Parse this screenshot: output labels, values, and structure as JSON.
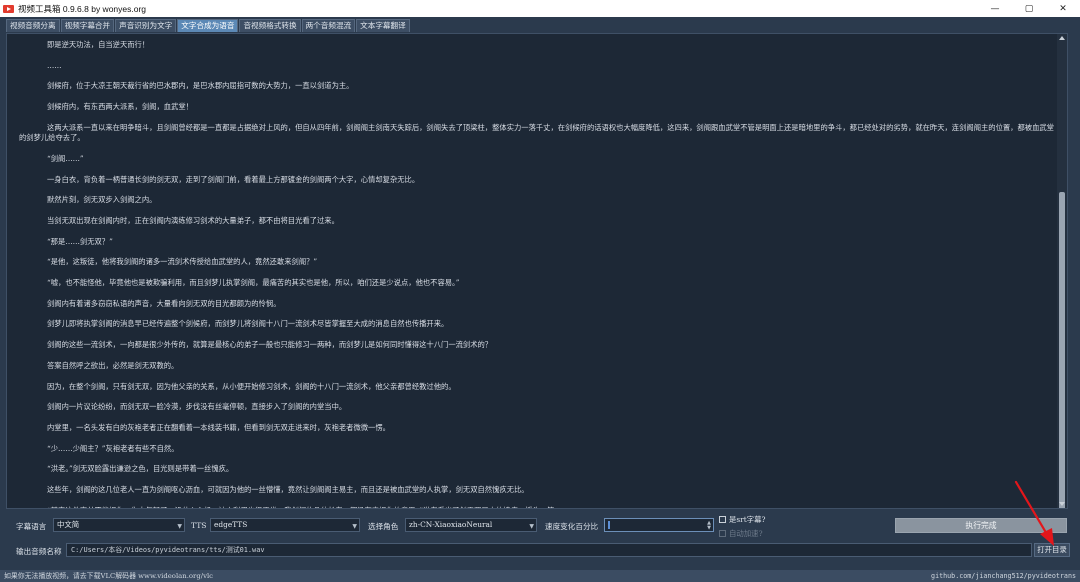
{
  "window": {
    "title": "视频工具箱 0.9.6.8 by wonyes.org",
    "controls": [
      "—",
      "▢",
      "✕"
    ]
  },
  "tabs": [
    {
      "label": "视频音频分离",
      "active": false
    },
    {
      "label": "视频字幕合并",
      "active": false
    },
    {
      "label": "声音识别为文字",
      "active": false
    },
    {
      "label": "文字合成为语音",
      "active": true
    },
    {
      "label": "音视频格式转换",
      "active": false
    },
    {
      "label": "两个音频混流",
      "active": false
    },
    {
      "label": "文本字幕翻译",
      "active": false
    }
  ],
  "text_content": [
    {
      "text": "即是逆天功法，自当逆天而行！",
      "wrap": false
    },
    {
      "text": "……",
      "wrap": false
    },
    {
      "text": "剑候府，位于大凉王朝天裁行省的巴水郡内，是巴水郡内屈指可数的大势力，一直以剑道为主。",
      "wrap": false
    },
    {
      "text": "剑候府内，有东西两大派系，剑阁，血武堂！",
      "wrap": false
    },
    {
      "text": "这两大派系一直以来在明争暗斗，且剑阁曾经都是一直都是占据绝对上风的，但自从四年前，剑阁阁主剑南天失踪后，剑阁失去了顶梁柱，整体实力一落千丈，在剑候府的话语权也大幅度降低，这四来，剑阁跟血武堂不管是明面上还是暗地里的争斗，都已经处对的劣势，就在昨天，连剑阁阁主的位置，都被血武堂的剑梦儿给夺去了。",
      "wrap": true
    },
    {
      "text": "“剑阁……”",
      "wrap": false
    },
    {
      "text": "一身白衣，背负着一柄普通长剑的剑无双，走到了剑阁门前，看着最上方那镀金的剑阁两个大字，心情却复杂无比。",
      "wrap": false
    },
    {
      "text": "默然片刻，剑无双步入剑阁之内。",
      "wrap": false
    },
    {
      "text": "当剑无双出现在剑阁内时，正在剑阁内演练修习剑术的大量弟子，都不由将目光看了过来。",
      "wrap": false
    },
    {
      "text": "“那是……剑无双？”",
      "wrap": false
    },
    {
      "text": "“是他，这叛徒，他将我剑阁的诸多一流剑术传授给血武堂的人，竟然还敢来剑阁？”",
      "wrap": false
    },
    {
      "text": "“嘘，也不能怪他，毕竟他也是被欺骗利用，而且剑梦儿执掌剑阁，最痛苦的其实也是他，所以，咱们还是少说点，他也不容易。”",
      "wrap": false
    },
    {
      "text": "剑阁内有着诸多窃窃私语的声音，大量看向剑无双的目光都颇为的怜悯。",
      "wrap": false
    },
    {
      "text": "剑梦儿即将执掌剑阁的消息早已经传遍整个剑候府，而剑梦儿将剑阁十八门一流剑术尽皆掌握至大成的消息自然也传播开来。",
      "wrap": false
    },
    {
      "text": "剑阁的这些一流剑术，一向都是很少外传的，就算是最核心的弟子一般也只能修习一两种，而剑梦儿是如何同时懂得这十八门一流剑术的？",
      "wrap": false
    },
    {
      "text": "答案自然呼之欲出，必然是剑无双教的。",
      "wrap": false
    },
    {
      "text": "因为，在整个剑阁，只有剑无双，因为他父亲的关系，从小便开始修习剑术，剑阁的十八门一流剑术，他父亲都曾经教过他的。",
      "wrap": false
    },
    {
      "text": "剑阁内一片议论纷纷，而剑无双一脸冷漠，步伐没有丝毫停顿，直接步入了剑阁的内堂当中。",
      "wrap": false
    },
    {
      "text": "内堂里，一名头发有白的灰袍老者正在翻看着一本线装书籍，但看到剑无双走进来时，灰袍老者微微一愣。",
      "wrap": false
    },
    {
      "text": "“少……少阁主？”灰袍老者有些不自然。",
      "wrap": false
    },
    {
      "text": "“洪老。”剑无双脸露出谦逊之色，目光则是带着一丝愧疚。",
      "wrap": false
    },
    {
      "text": "这些年，剑阁的这几位老人一直为剑阁呕心沥血，可就因为他的一丝懵懂，竟然让剑阁阁主易主，而且还是被血武堂的人执掌，剑无双自然愧疚无比。",
      "wrap": false
    },
    {
      "text": "“其实这件事并不能怪你，你太年轻了，没什么心机，被人利用也很正常，我剑阁的几位长老，都没有责怪你的意思。”洪老看出了剑无双目中的愧疚，摇头一笑。",
      "wrap": false
    },
    {
      "text": "“真要怪的话，就只能怪那剑凰，还有剑梦儿，手段太不光彩，特别是那剑梦儿，我之前好歹也见过她几面，就是我都没有想到，她竟然隐藏的那般深，小小年纪便有如此心机，将来的成就，怕是非同小可，剑阁落入她的手中，其实也不算太坏。”",
      "wrap": false
    },
    {
      "text": "“剑阁，永远只能由剑阁弟子执掌。”剑无双却是无比坚定道。",
      "wrap": false
    },
    {
      "text": "洪老一怔，跟着却是无奈的摇头。",
      "wrap": false
    }
  ],
  "controls": {
    "subtitle_lang_label": "字幕语言",
    "subtitle_lang_value": "中文简",
    "tts_label": "TTS",
    "tts_value": "edgeTTS",
    "voice_label": "选择角色",
    "voice_value": "zh-CN-XiaoxiaoNeural",
    "speed_label": "速度变化百分比",
    "srt_checkbox_label": "是srt字幕?",
    "auto_speed_label": "自动加速?",
    "execute_button": "执行完成",
    "output_label": "输出音频名称",
    "output_path": "C:/Users/本谷/Videos/pyvideotrans/tts/测试01.wav",
    "open_dir_button": "打开目录"
  },
  "statusbar": {
    "left": "如果你无法播放视频，请去下载VLC解码器 www.videolan.org/vlc",
    "right": "github.com/jianchang512/pyvideotrans"
  },
  "colors": {
    "background": "#2b3a4d",
    "active_tab": "#5c89b6",
    "annotation_arrow": "#e3161b"
  }
}
